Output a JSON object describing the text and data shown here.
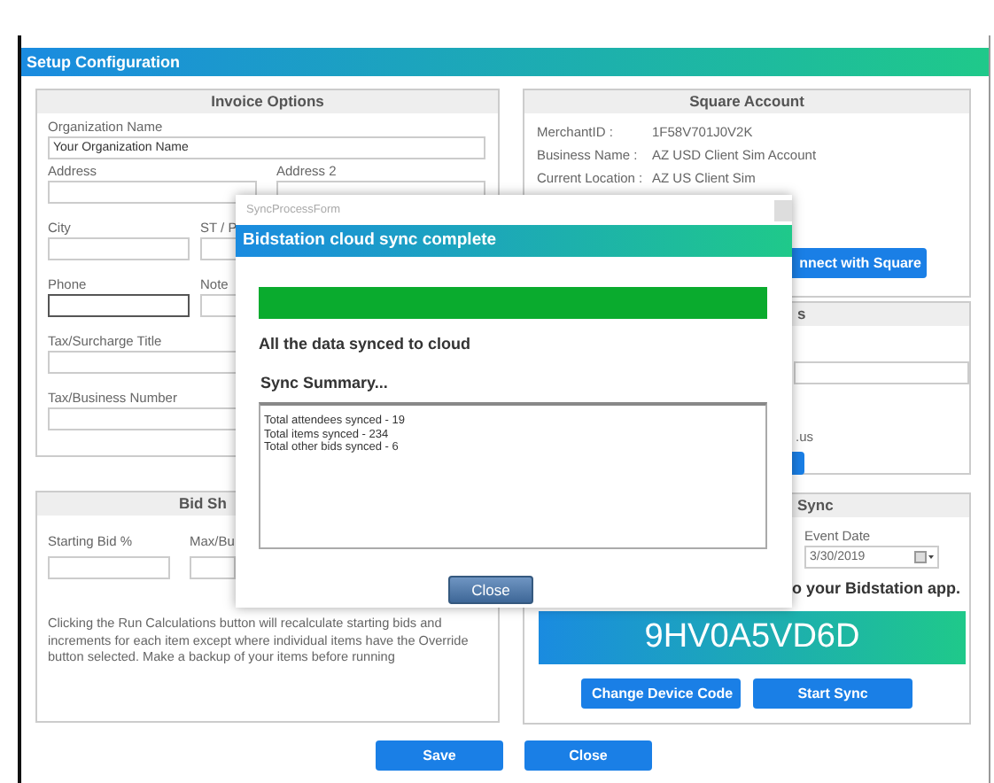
{
  "window": {
    "title": "Setup Configuration"
  },
  "invoice_options": {
    "title": "Invoice Options",
    "rows": [
      {
        "kind": "wide",
        "fields": [
          {
            "label": "Organization Name",
            "value": "Your Organization Name",
            "focused": false
          }
        ]
      },
      {
        "kind": "half",
        "fields": [
          {
            "label": "Address",
            "focused": false
          },
          {
            "label": "Address 2",
            "focused": false
          }
        ]
      },
      {
        "kind": "third",
        "fields": [
          {
            "label": "City",
            "focused": false
          },
          {
            "label": "ST / P",
            "focused": false
          }
        ]
      },
      {
        "kind": "third",
        "fields": [
          {
            "label": "Phone",
            "focused": true
          },
          {
            "label": "Note",
            "focused": false
          }
        ]
      },
      {
        "kind": "short",
        "fields": [
          {
            "label": "Tax/Surcharge Title",
            "focused": false
          }
        ]
      },
      {
        "kind": "short",
        "fields": [
          {
            "label": "Tax/Business Number",
            "focused": false
          }
        ]
      }
    ]
  },
  "bid_panel": {
    "title": "Bid Sh",
    "fields": [
      {
        "label": "Starting Bid %"
      },
      {
        "label": "Max/Bu"
      }
    ],
    "note": "Clicking the Run Calculations button will recalculate starting bids and increments for each item except where individual items have the Override button selected. Make a backup of your items before running"
  },
  "square_account": {
    "title": "Square Account",
    "rows": [
      {
        "label": "MerchantID :",
        "value": "1F58V701J0V2K"
      },
      {
        "label": "Business Name :",
        "value": "AZ USD Client Sim Account"
      },
      {
        "label": "Current Location :",
        "value": "AZ US Client Sim"
      }
    ],
    "button": "nnect with Square"
  },
  "panel_2": {
    "title": "s",
    "text": ".us"
  },
  "sync_panel": {
    "title": "Sync",
    "event_date_label": "Event Date",
    "event_date": "3/30/2019",
    "instruction": "o your Bidstation app.",
    "device_code": "9HV0A5VD6D",
    "buttons": [
      "Change Device Code",
      "Start Sync"
    ]
  },
  "footer_buttons": [
    "Save",
    "Close"
  ],
  "dialog": {
    "form_name": "SyncProcessForm",
    "title": "Bidstation cloud sync complete",
    "progress": {
      "level": 1
    },
    "message": "All the data synced to cloud",
    "summary_title": "Sync Summary...",
    "summary_lines": [
      "Total attendees synced - 19",
      "Total items synced - 234",
      "Total other bids synced - 6"
    ],
    "button": "Close"
  }
}
